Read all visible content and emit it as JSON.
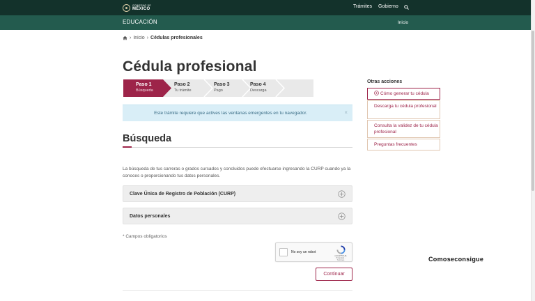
{
  "header": {
    "logo_line1": "GOBIERNO DE",
    "logo_line2": "MÉXICO",
    "nav": [
      "Trámites",
      "Gobierno"
    ],
    "search_icon": "search-icon"
  },
  "subheader": {
    "title": "EDUCACIÓN",
    "link": "Inicio"
  },
  "breadcrumb": {
    "home_icon": "home-icon",
    "separator": "›",
    "items": [
      "Inicio",
      "Cédulas profesionales"
    ]
  },
  "page": {
    "title": "Cédula profesional"
  },
  "steps": [
    {
      "title": "Paso 1",
      "subtitle": "Búsqueda",
      "active": true
    },
    {
      "title": "Paso 2",
      "subtitle": "Tu trámite",
      "active": false
    },
    {
      "title": "Paso 3",
      "subtitle": "Pago",
      "active": false
    },
    {
      "title": "Paso 4",
      "subtitle": "Descarga",
      "active": false
    }
  ],
  "alert": {
    "text": "Este trámite requiere que actives las ventanas emergentes en tu navegador.",
    "close": "×"
  },
  "search": {
    "title": "Búsqueda",
    "intro": "La búsqueda de tus carreras o grados cursados y concluidos puede efectuarse ingresando la CURP cuando ya la conoces o proporcionando tus datos personales.",
    "accordions": [
      {
        "label": "Clave Única de Registro de Población (CURP)",
        "icon": "plus-circle-icon"
      },
      {
        "label": "Datos personales",
        "icon": "plus-circle-icon"
      }
    ],
    "required_note": "* Campos obligatorios",
    "captcha": {
      "label": "No soy un robot",
      "brand": "reCAPTCHA",
      "terms": "Privacidad - Términos"
    },
    "continue": "Continuar"
  },
  "sidebar": {
    "title": "Otras acciones",
    "items": [
      {
        "label": "Cómo generar tu cédula",
        "icon": "play-circle-icon",
        "active": true
      },
      {
        "label": "Descarga tu cédula profesional",
        "active": false
      },
      {
        "label": "Consulta la validez de tu cédula profesional",
        "active": false
      },
      {
        "label": "Preguntas frecuentes",
        "active": false
      }
    ]
  },
  "watermark": "Comoseconsigue",
  "colors": {
    "topbar": "#13322b",
    "subbar": "#235b4e",
    "accent": "#9d2449",
    "alert_bg": "#d9eef7",
    "step_inactive": "#e9e9e9"
  }
}
